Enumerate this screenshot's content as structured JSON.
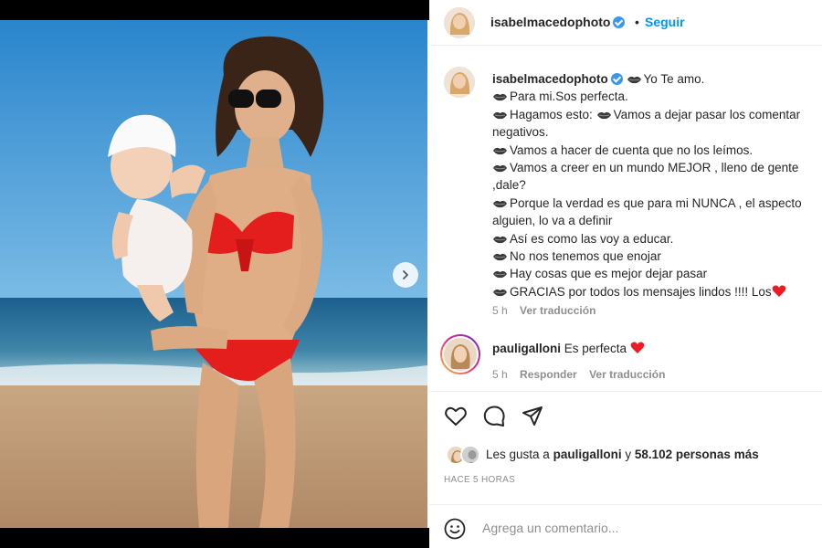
{
  "post": {
    "username": "isabelmacedophoto",
    "separator": "•",
    "follow_label": "Seguir"
  },
  "caption": {
    "username": "isabelmacedophoto",
    "lines": [
      "Yo Te amo.",
      "Para mi.Sos perfecta.",
      "Hagamos esto:",
      "Vamos a dejar pasar los comentar",
      "negativos.",
      "Vamos a hacer de cuenta que no los leímos.",
      "Vamos a creer en un mundo MEJOR , lleno de gente",
      ",dale?",
      "Porque la verdad es que para mi NUNCA , el aspecto",
      "alguien, lo va a definir",
      "Así es como las voy a educar.",
      "No nos tenemos que enojar",
      "Hay cosas que es mejor dejar pasar",
      "GRACIAS por todos los mensajes lindos !!!! Los"
    ],
    "age": "5 h",
    "translate_label": "Ver traducción"
  },
  "comment": {
    "username": "pauligalloni",
    "text": "Es perfecta",
    "age": "5 h",
    "reply_label": "Responder",
    "translate_label": "Ver traducción"
  },
  "likes": {
    "prefix": "Les gusta a",
    "user": "pauligalloni",
    "conj": "y",
    "count_text": "58.102 personas más"
  },
  "timestamp": "HACE 5 HORAS",
  "add_comment": {
    "placeholder": "Agrega un comentario..."
  },
  "icons": {
    "like": "heart-outline-icon",
    "comment": "comment-bubble-icon",
    "share": "paper-plane-icon",
    "emoji": "smiley-icon",
    "next": "chevron-right-icon",
    "verified": "verified-badge-icon"
  },
  "colors": {
    "link": "#0095f6",
    "verified": "#3897f0",
    "heart": "#ed1c24",
    "muted": "#8e8e8e"
  },
  "carousel": {
    "count": 3,
    "active": 2
  }
}
